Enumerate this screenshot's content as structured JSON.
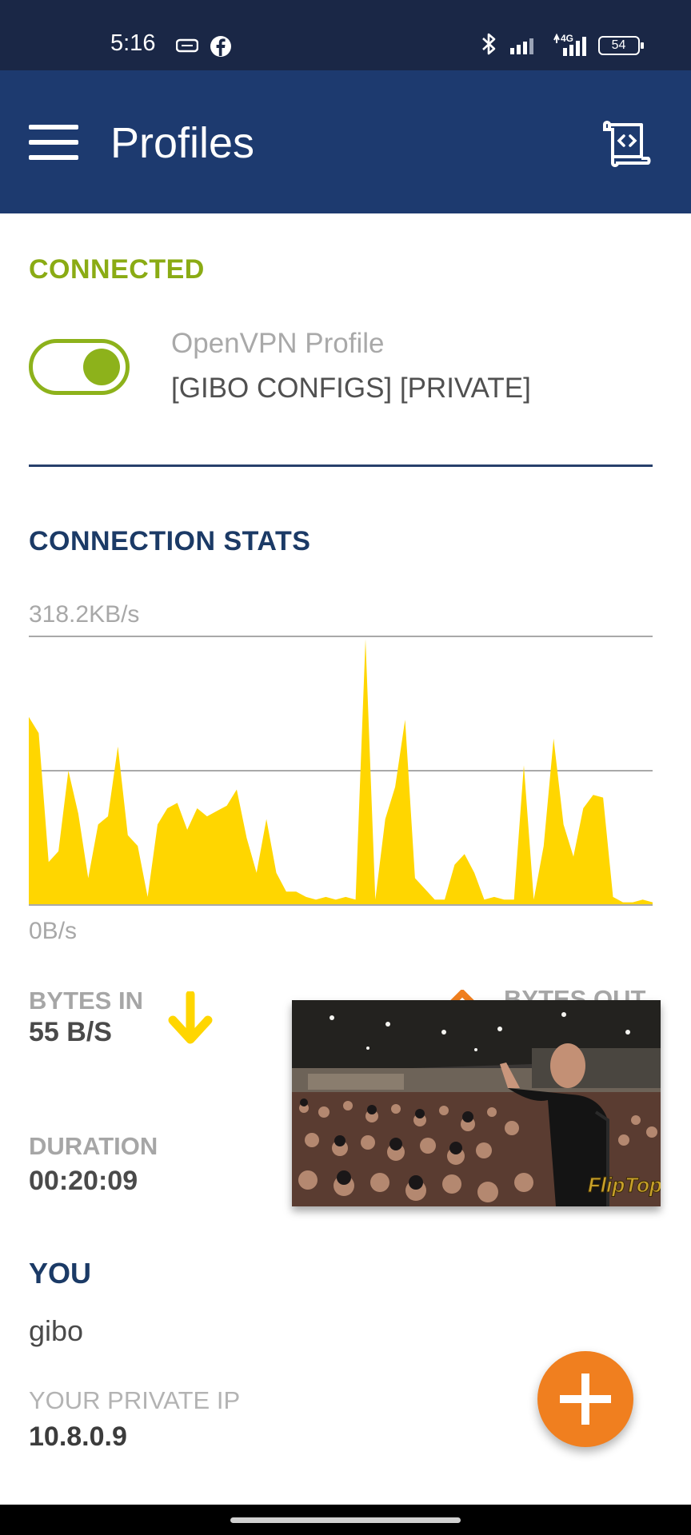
{
  "status_bar": {
    "time": "5:16",
    "battery": "54",
    "network_type": "4G",
    "icons": [
      "sim-card-icon",
      "facebook-icon",
      "bluetooth-icon",
      "signal-icon",
      "mobile-data-icon",
      "battery-icon"
    ]
  },
  "app_bar": {
    "title": "Profiles",
    "menu_icon": "hamburger-menu-icon",
    "action_icon": "import-profile-icon"
  },
  "connection": {
    "status_label": "CONNECTED",
    "toggle_on": true,
    "profile_name": "OpenVPN Profile",
    "server_name": "[GIBO CONFIGS] [PRIVATE]"
  },
  "stats": {
    "section_label": "CONNECTION STATS",
    "bytes_in_label": "BYTES IN",
    "bytes_in_value": "55 B/S",
    "bytes_out_label": "BYTES OUT",
    "duration_label": "DURATION",
    "duration_value": "00:20:09"
  },
  "chart_data": {
    "type": "area",
    "y_max_label": "318.2KB/s",
    "y_min_label": "0B/s",
    "color": "#ffd600",
    "gridlines": [
      1.0,
      0.5
    ],
    "values": [
      0.7,
      0.64,
      0.16,
      0.2,
      0.5,
      0.34,
      0.1,
      0.3,
      0.33,
      0.59,
      0.26,
      0.22,
      0.03,
      0.3,
      0.36,
      0.38,
      0.28,
      0.36,
      0.33,
      0.35,
      0.37,
      0.43,
      0.25,
      0.12,
      0.32,
      0.12,
      0.05,
      0.05,
      0.03,
      0.02,
      0.03,
      0.02,
      0.03,
      0.02,
      0.99,
      0.02,
      0.32,
      0.44,
      0.69,
      0.1,
      0.06,
      0.02,
      0.02,
      0.15,
      0.19,
      0.12,
      0.02,
      0.03,
      0.02,
      0.02,
      0.52,
      0.02,
      0.22,
      0.62,
      0.3,
      0.18,
      0.36,
      0.41,
      0.4,
      0.03,
      0.01,
      0.01,
      0.02,
      0.01
    ]
  },
  "you": {
    "label": "YOU",
    "username": "gibo",
    "private_ip_label": "YOUR PRIVATE IP",
    "private_ip": "10.8.0.9"
  },
  "overlay": {
    "video_watermark": "FlipTop"
  },
  "colors": {
    "status_bar": "#1a2746",
    "app_bar": "#1d3a6f",
    "connected_green": "#8db21b",
    "navy_text": "#1b3a66",
    "chart_yellow": "#ffd600",
    "fab_orange": "#f07f1f"
  },
  "fab": {
    "icon": "add-icon"
  }
}
